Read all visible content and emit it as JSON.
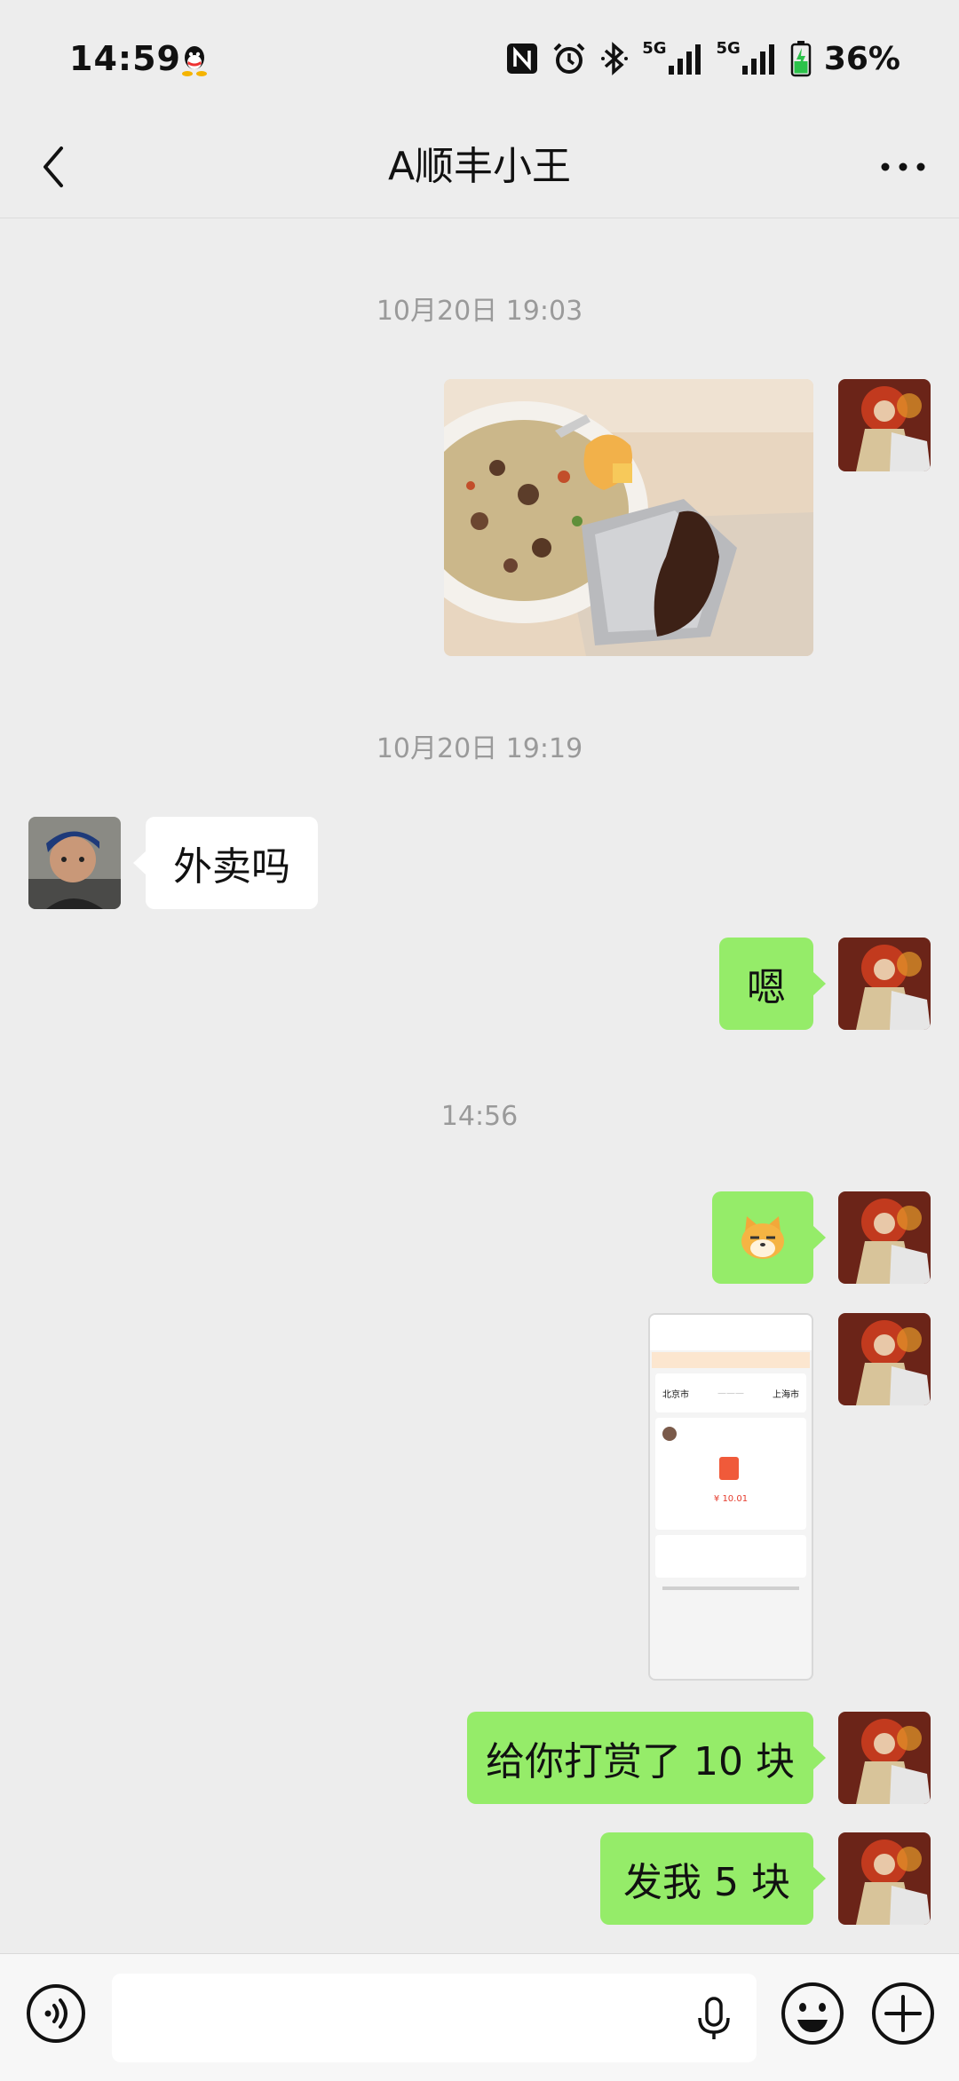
{
  "status_bar": {
    "time": "14:59",
    "battery": "36%",
    "network_1": "5G",
    "network_2": "5G",
    "icons": [
      "qq-icon",
      "nfc-icon",
      "alarm-icon",
      "bluetooth-icon",
      "signal-icon",
      "battery-icon"
    ]
  },
  "header": {
    "title": "A顺丰小王",
    "back_icon": "back-arrow-icon",
    "more_icon": "more-dots-icon"
  },
  "messages": [
    {
      "type": "timestamp",
      "text": "10月20日 19:03"
    },
    {
      "type": "image",
      "side": "right",
      "content": "food photo"
    },
    {
      "type": "timestamp",
      "text": "10月20日 19:19"
    },
    {
      "type": "text",
      "side": "left",
      "text": "外卖吗"
    },
    {
      "type": "text",
      "side": "right",
      "text": "嗯"
    },
    {
      "type": "timestamp",
      "text": "14:56"
    },
    {
      "type": "sticker",
      "side": "right",
      "text": "🐱"
    },
    {
      "type": "image",
      "side": "right",
      "content": "app screenshot"
    },
    {
      "type": "text",
      "side": "right",
      "text": "给你打赏了 10 块"
    },
    {
      "type": "text",
      "side": "right",
      "text": "发我 5 块"
    }
  ],
  "screenshot_thumb": {
    "from_city": "北京市",
    "to_city": "上海市",
    "tip_amount": "¥ 10.01"
  },
  "input_bar": {
    "placeholder": "",
    "icons": [
      "voice-icon",
      "mic-icon",
      "emoji-icon",
      "plus-icon"
    ]
  },
  "colors": {
    "background": "#ededed",
    "outgoing_bubble": "#95ec69",
    "incoming_bubble": "#ffffff",
    "timestamp_text": "#9a9a9a"
  }
}
